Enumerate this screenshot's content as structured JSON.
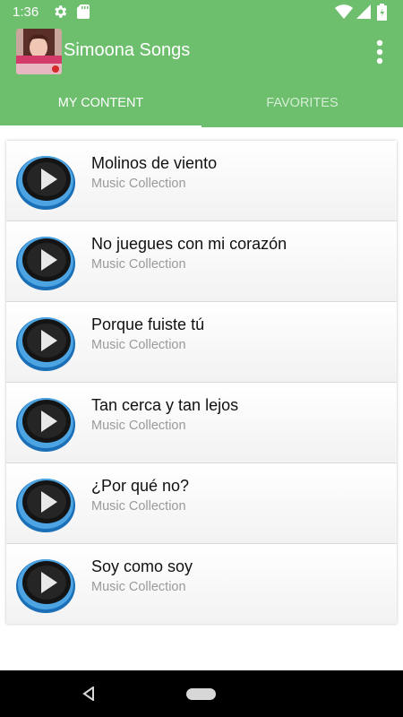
{
  "status_bar": {
    "time": "1:36",
    "icons": [
      "gear-icon",
      "sd-card-icon",
      "wifi-icon",
      "signal-icon",
      "battery-icon"
    ]
  },
  "app": {
    "title": "Simoona Songs",
    "logo_text": "SIMONA",
    "accent_color": "#6dbf6e"
  },
  "tabs": [
    {
      "label": "MY CONTENT",
      "selected": true
    },
    {
      "label": "FAVORITES",
      "selected": false
    }
  ],
  "songs": [
    {
      "title": "Molinos de viento",
      "subtitle": "Music Collection"
    },
    {
      "title": "No juegues con mi corazón",
      "subtitle": "Music Collection"
    },
    {
      "title": "Porque fuiste tú",
      "subtitle": "Music Collection"
    },
    {
      "title": "Tan cerca y tan lejos",
      "subtitle": "Music Collection"
    },
    {
      "title": "¿Por qué no?",
      "subtitle": "Music Collection"
    },
    {
      "title": "Soy como soy",
      "subtitle": "Music Collection"
    }
  ]
}
